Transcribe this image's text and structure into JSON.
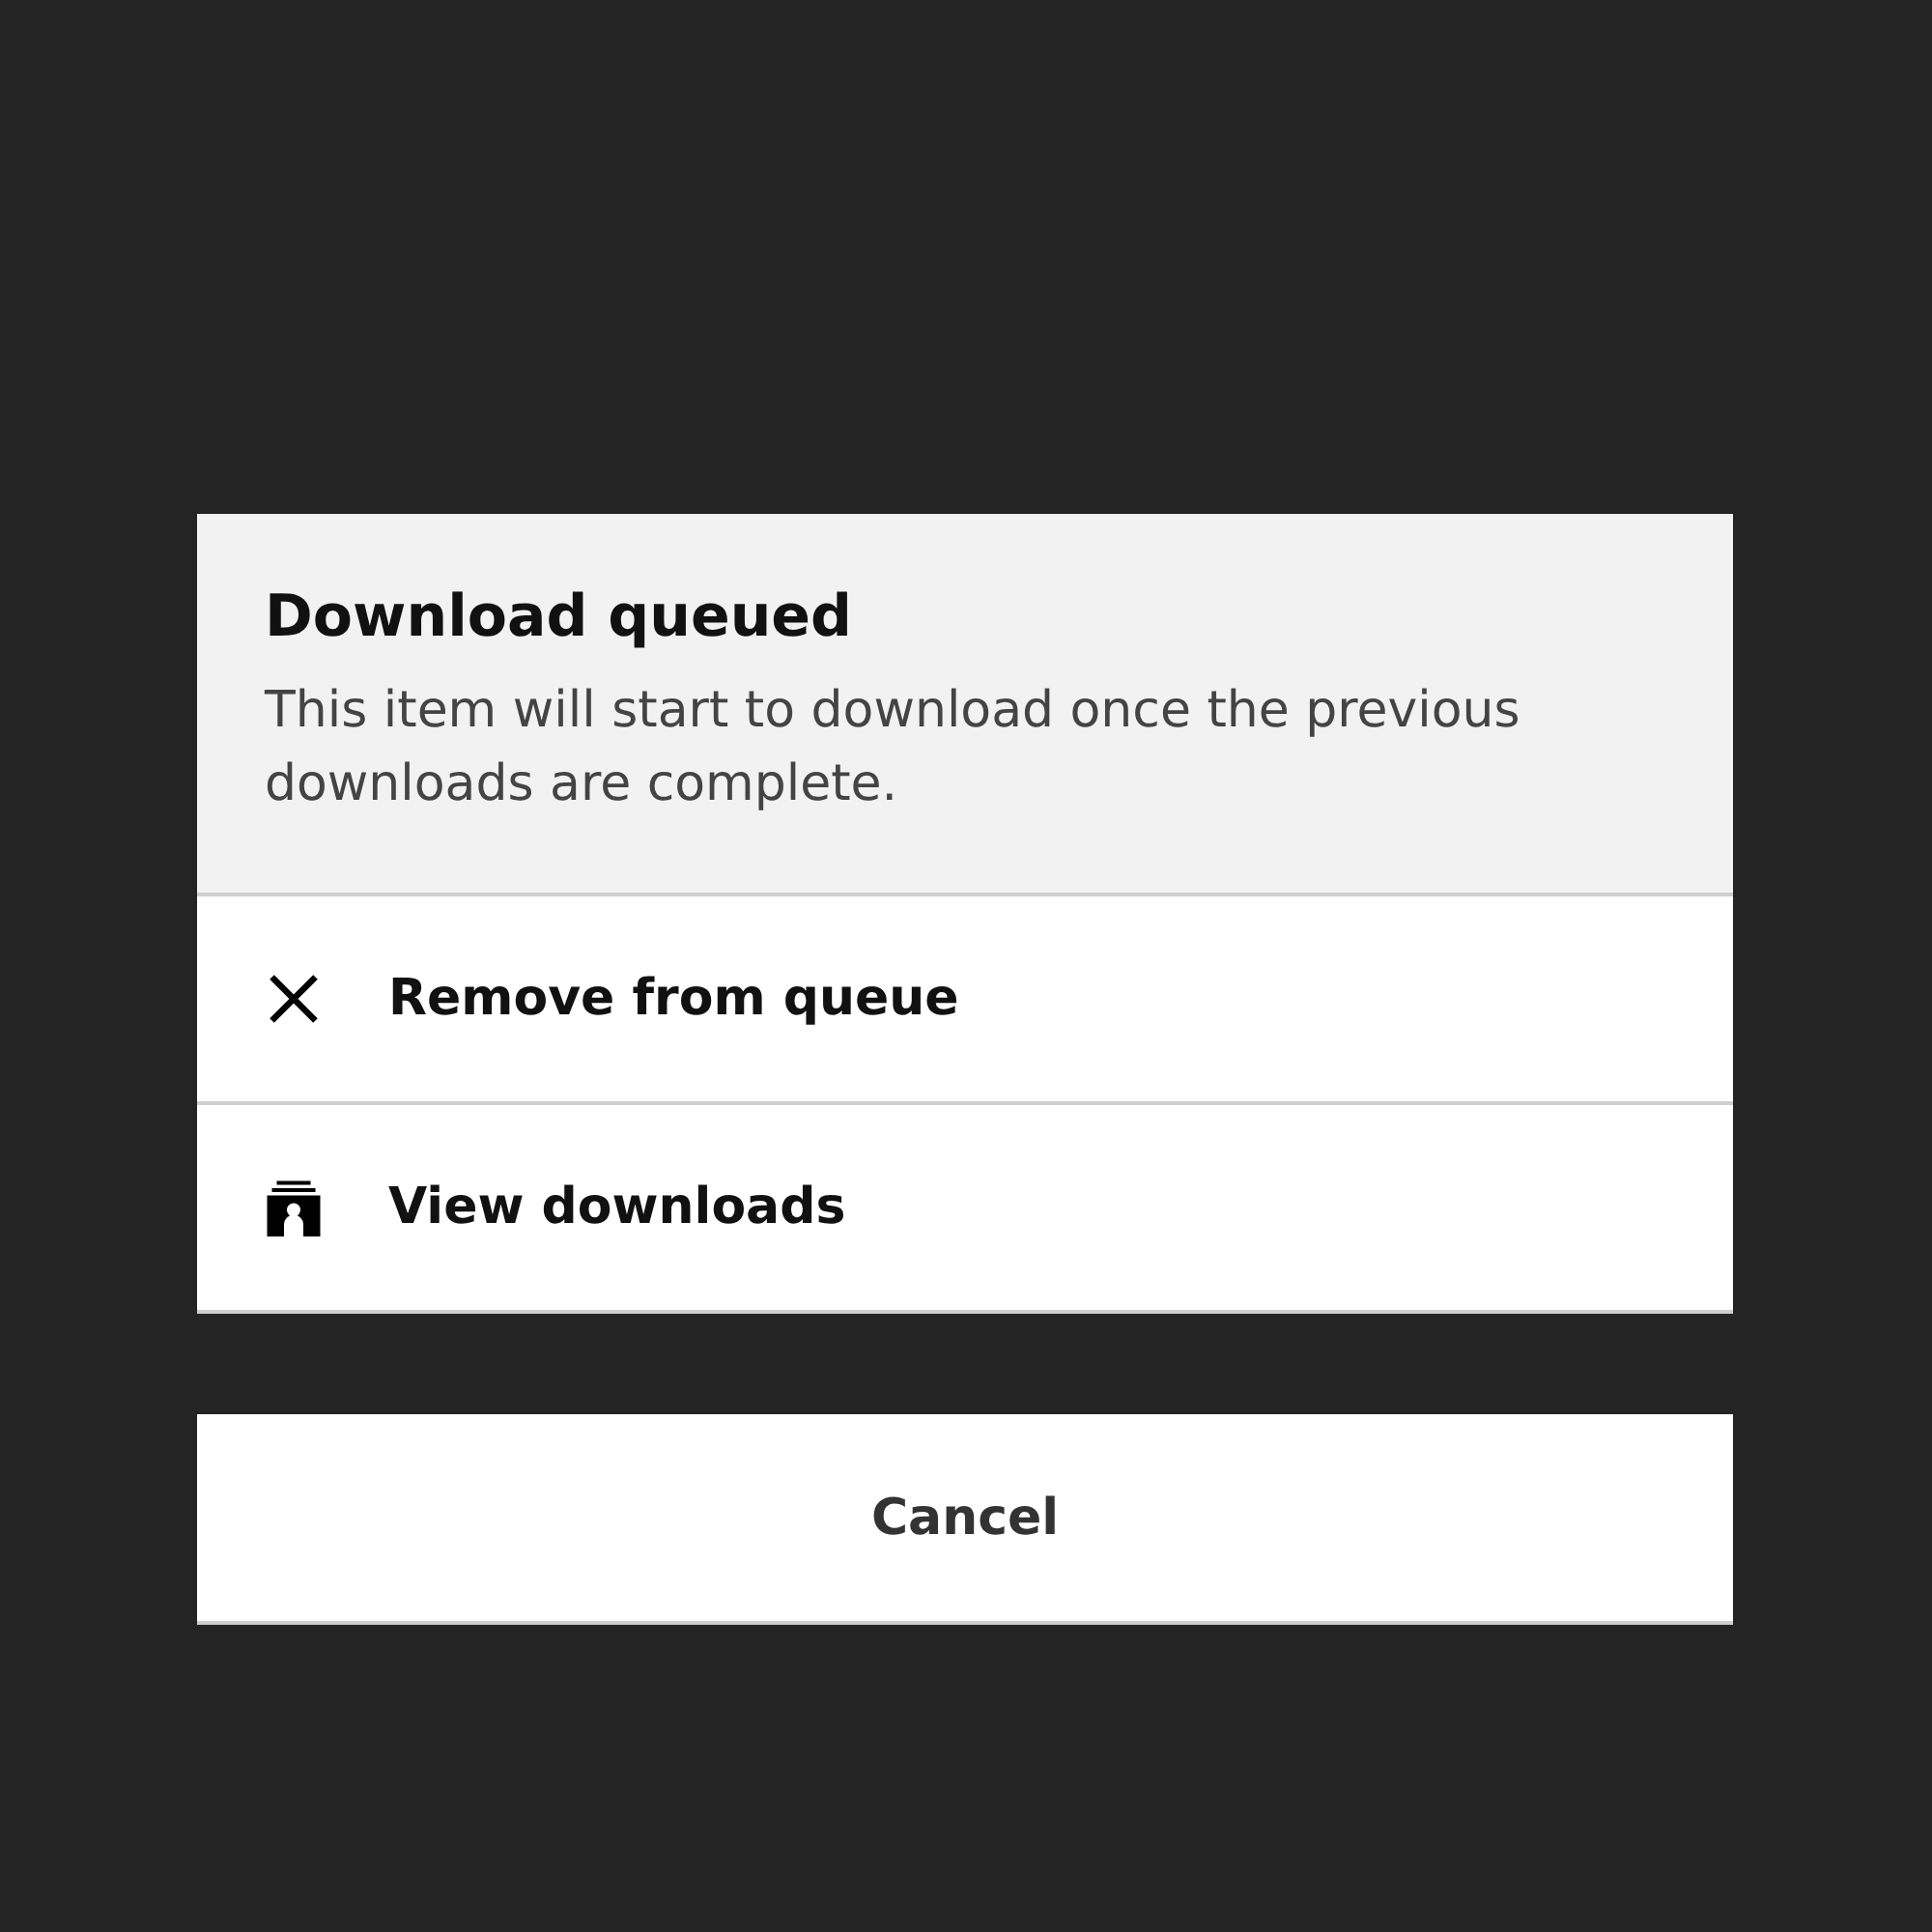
{
  "dialog": {
    "title": "Download queued",
    "message": "This item will start to download once the previous downloads are complete.",
    "actions": [
      {
        "kind": "close",
        "label": "Remove from queue"
      },
      {
        "kind": "downloads",
        "label": "View downloads"
      }
    ]
  },
  "cancel": {
    "label": "Cancel"
  }
}
